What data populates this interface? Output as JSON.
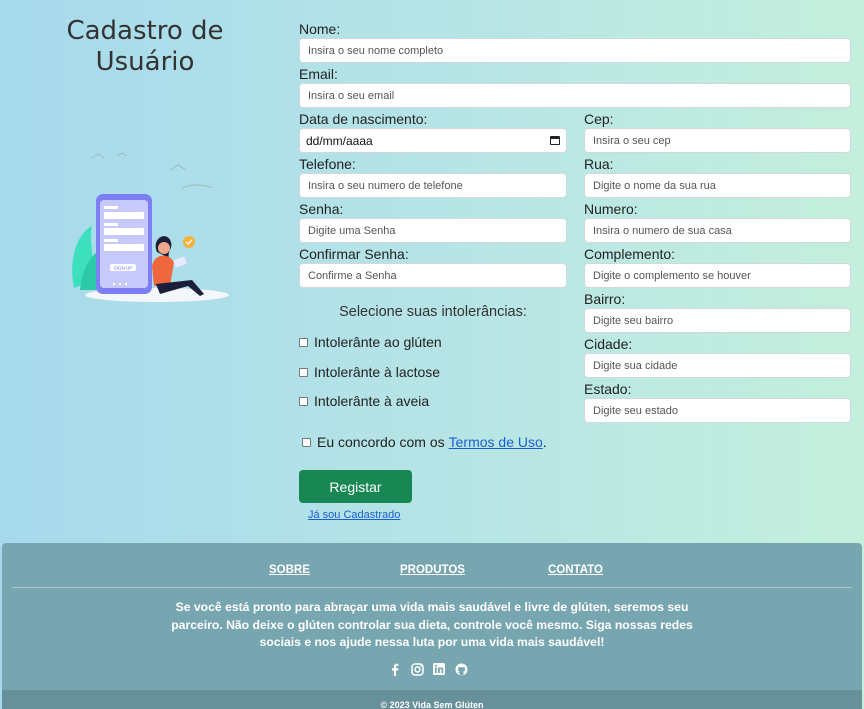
{
  "page": {
    "title": "Cadastro de Usuário"
  },
  "form": {
    "nome": {
      "label": "Nome:",
      "placeholder": "Insira o seu nome completo"
    },
    "email": {
      "label": "Email:",
      "placeholder": "Insira o seu email"
    },
    "nascimento": {
      "label": "Data de nascimento:",
      "value": "dd/mm/aaaa"
    },
    "cep": {
      "label": "Cep:",
      "placeholder": "Insira o seu cep"
    },
    "telefone": {
      "label": "Telefone:",
      "placeholder": "Insira o seu numero de telefone"
    },
    "rua": {
      "label": "Rua:",
      "placeholder": "Digite o nome da sua rua"
    },
    "senha": {
      "label": "Senha:",
      "placeholder": "Digite uma Senha"
    },
    "numero": {
      "label": "Numero:",
      "placeholder": "Insira o numero de sua casa"
    },
    "confirmar": {
      "label": "Confirmar Senha:",
      "placeholder": "Confirme a Senha"
    },
    "complemento": {
      "label": "Complemento:",
      "placeholder": "Digite o complemento se houver"
    },
    "bairro": {
      "label": "Bairro:",
      "placeholder": "Digite seu bairro"
    },
    "cidade": {
      "label": "Cidade:",
      "placeholder": "Digite sua cidade"
    },
    "estado": {
      "label": "Estado:",
      "placeholder": "Digite seu estado"
    },
    "intolerancias_title": "Selecione suas intolerâncias:",
    "intolerancias": [
      "Intolerânte ao glúten",
      "Intolerânte à lactose",
      "Intolerânte à aveia"
    ],
    "terms_text": "Eu concordo com os",
    "terms_link": "Termos de Uso",
    "terms_end": ".",
    "submit": "Registar",
    "login_link": "Já sou Cadastrado"
  },
  "illustration": {
    "button_text": "SIGN UP"
  },
  "footer": {
    "nav": [
      "SOBRE",
      "PRODUTOS",
      "CONTATO"
    ],
    "text": "Se você está pronto para abraçar uma vida mais saudável e livre de glúten, seremos seu parceiro. Não deixe o glúten controlar sua dieta, controle você mesmo. Siga nossas redes sociais e nos ajude nessa luta por uma vida mais saudável!",
    "social_icons": [
      "facebook-icon",
      "instagram-icon",
      "linkedin-icon",
      "github-icon"
    ],
    "copyright": "© 2023 Vida Sem Glúten"
  }
}
